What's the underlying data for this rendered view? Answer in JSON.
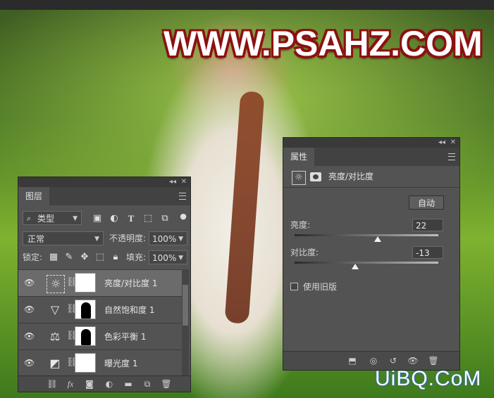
{
  "watermarks": {
    "top": "WWW.PSAHZ.COM",
    "bottom": "UiBQ.CoM"
  },
  "layers_panel": {
    "tab": "图层",
    "filter_kind": "类型",
    "blend_mode": "正常",
    "opacity_label": "不透明度:",
    "opacity_value": "100%",
    "lock_label": "锁定:",
    "fill_label": "填充:",
    "fill_value": "100%",
    "layers": [
      {
        "name": "亮度/对比度 1",
        "icon": "brightness-contrast-icon",
        "mask": "white",
        "selected": true
      },
      {
        "name": "自然饱和度 1",
        "icon": "vibrance-icon",
        "mask": "silhouette",
        "selected": false
      },
      {
        "name": "色彩平衡 1",
        "icon": "color-balance-icon",
        "mask": "silhouette",
        "selected": false
      },
      {
        "name": "曝光度 1",
        "icon": "exposure-icon",
        "mask": "white",
        "selected": false
      }
    ]
  },
  "properties_panel": {
    "tab": "属性",
    "header_title": "亮度/对比度",
    "auto_button": "自动",
    "brightness_label": "亮度:",
    "brightness_value": "22",
    "brightness_fraction": 0.58,
    "contrast_label": "对比度:",
    "contrast_value": "-13",
    "contrast_fraction": 0.42,
    "legacy_label": "使用旧版",
    "legacy_checked": false
  }
}
